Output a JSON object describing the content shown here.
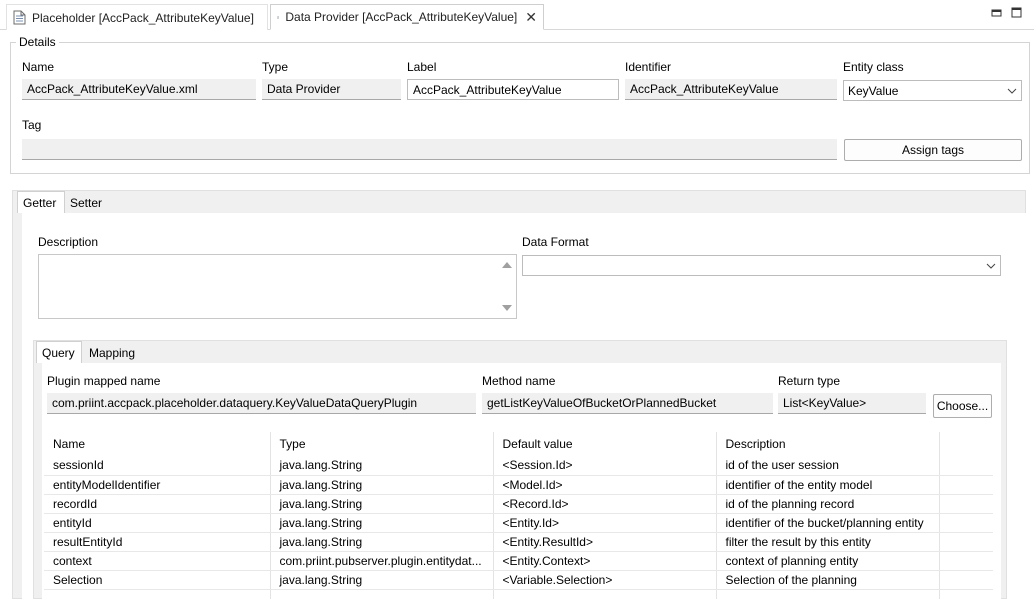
{
  "editor_tabs": [
    {
      "label": "Placeholder [AccPack_AttributeKeyValue]"
    },
    {
      "label": "Data Provider [AccPack_AttributeKeyValue]"
    }
  ],
  "details": {
    "group_label": "Details",
    "name_label": "Name",
    "name_value": "AccPack_AttributeKeyValue.xml",
    "type_label": "Type",
    "type_value": "Data Provider",
    "label_label": "Label",
    "label_value": "AccPack_AttributeKeyValue",
    "identifier_label": "Identifier",
    "identifier_value": "AccPack_AttributeKeyValue",
    "entity_class_label": "Entity class",
    "entity_class_value": "KeyValue",
    "tag_label": "Tag",
    "tag_value": "",
    "assign_tags_label": "Assign tags"
  },
  "outer_tabs": {
    "getter": "Getter",
    "setter": "Setter"
  },
  "getter": {
    "description_label": "Description",
    "description_value": "",
    "data_format_label": "Data Format",
    "data_format_value": ""
  },
  "inner_tabs": {
    "query": "Query",
    "mapping": "Mapping"
  },
  "query": {
    "plugin_label": "Plugin mapped name",
    "plugin_value": "com.priint.accpack.placeholder.dataquery.KeyValueDataQueryPlugin",
    "method_label": "Method name",
    "method_value": "getListKeyValueOfBucketOrPlannedBucket",
    "return_label": "Return type",
    "return_value": "List<KeyValue>",
    "choose_label": "Choose..."
  },
  "params_table": {
    "headers": [
      "Name",
      "Type",
      "Default value",
      "Description"
    ],
    "rows": [
      [
        "sessionId",
        "java.lang.String",
        "<Session.Id>",
        "id of the user session"
      ],
      [
        "entityModelIdentifier",
        "java.lang.String",
        "<Model.Id>",
        "identifier of the entity model"
      ],
      [
        "recordId",
        "java.lang.String",
        "<Record.Id>",
        "id of the planning record"
      ],
      [
        "entityId",
        "java.lang.String",
        "<Entity.Id>",
        "identifier of the bucket/planning entity"
      ],
      [
        "resultEntityId",
        "java.lang.String",
        "<Entity.ResultId>",
        "filter the result by this entity"
      ],
      [
        "context",
        "com.priint.pubserver.plugin.entitydat...",
        "<Entity.Context>",
        "context of planning entity"
      ],
      [
        "Selection",
        "java.lang.String",
        "<Variable.Selection>",
        "Selection of the planning"
      ]
    ]
  },
  "icons": {
    "file": "file-icon",
    "close": "close-icon",
    "minimize": "minimize-icon",
    "maximize": "maximize-icon",
    "dropdown": "chevron-down-icon",
    "scroll_up": "scroll-up-arrow-icon",
    "scroll_down": "scroll-down-arrow-icon"
  },
  "colors": {
    "panel": "#f0f0f0",
    "border": "#d4d4d4",
    "field": "#f0f0f0"
  }
}
